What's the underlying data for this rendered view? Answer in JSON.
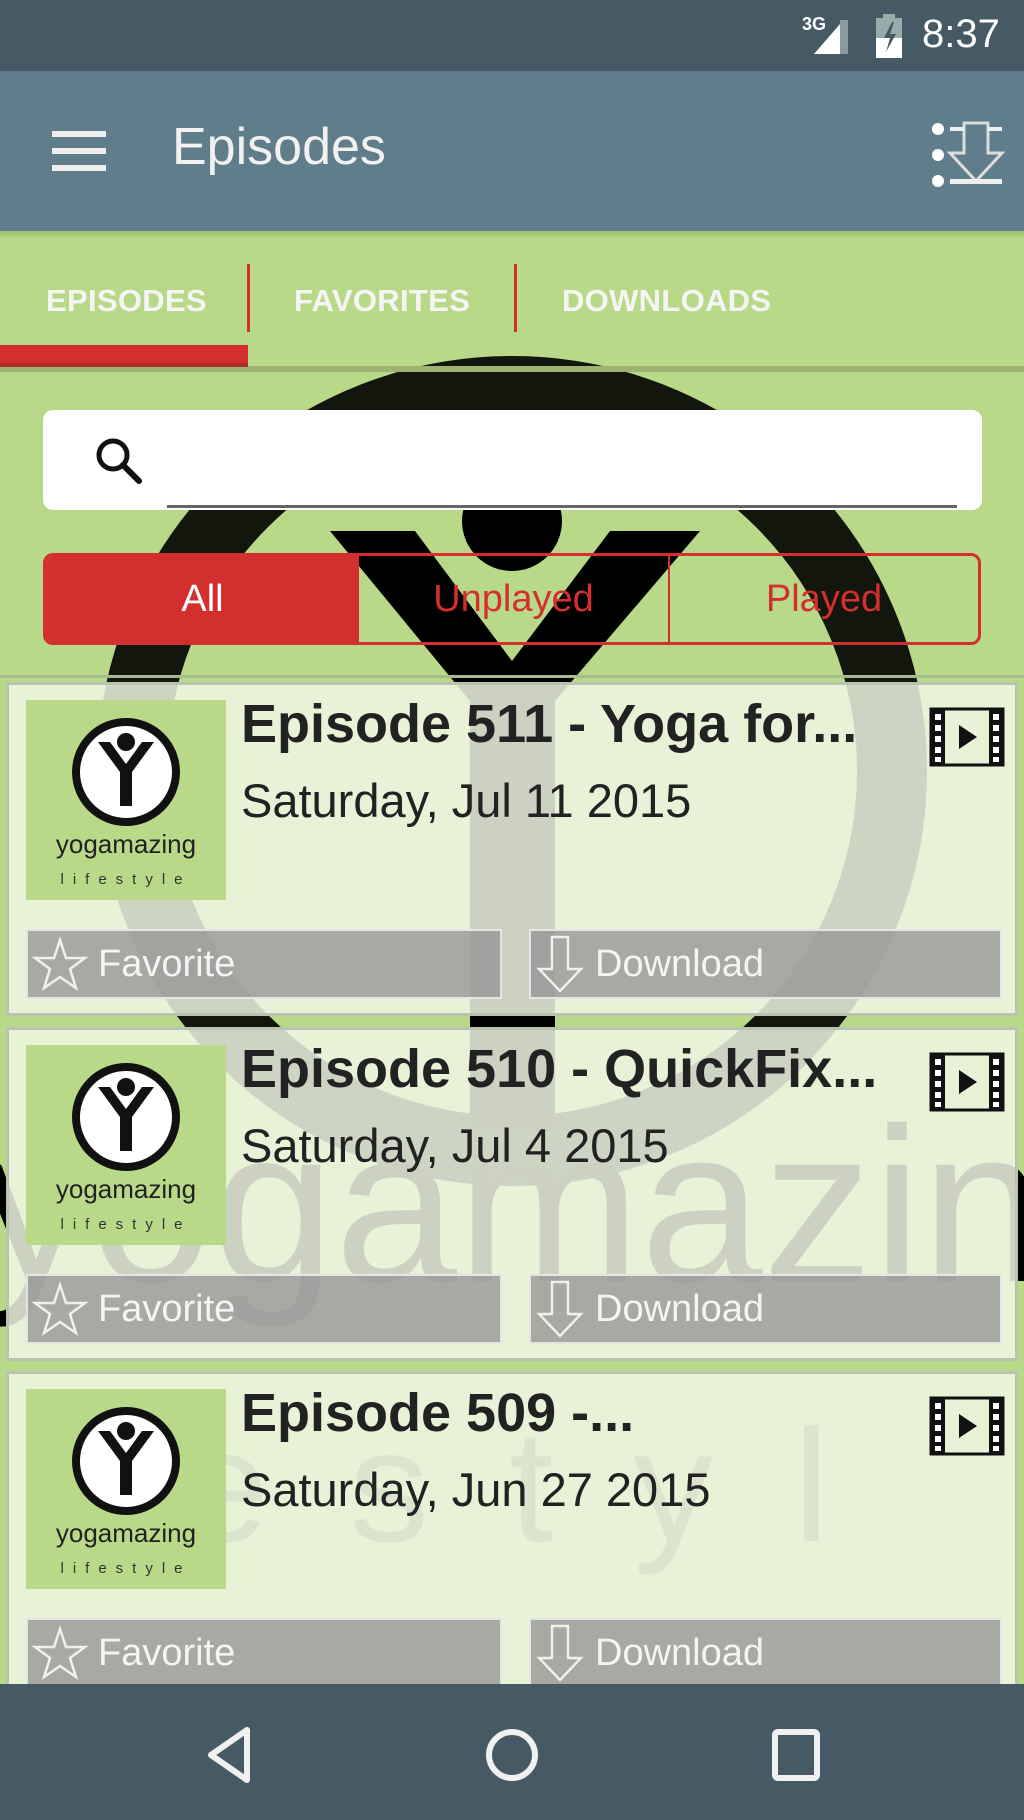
{
  "status_bar": {
    "network": "3G",
    "time": "8:37"
  },
  "app_bar": {
    "title": "Episodes",
    "menu_icon": "hamburger-menu-icon",
    "action_icon": "download-all-icon"
  },
  "tabs": [
    {
      "label": "EPISODES",
      "active": true
    },
    {
      "label": "FAVORITES",
      "active": false
    },
    {
      "label": "DOWNLOADS",
      "active": false
    }
  ],
  "search": {
    "icon": "search-icon",
    "value": "",
    "placeholder": ""
  },
  "filter": {
    "options": [
      "All",
      "Unplayed",
      "Played"
    ],
    "selected": "All"
  },
  "colors": {
    "accent": "#d32f2f",
    "app_bar": "#607d8b",
    "status_bar": "#455a64",
    "background": "#b8d987"
  },
  "episodes": [
    {
      "title": "Episode 511 - Yoga for...",
      "date": "Saturday, Jul 11 2015",
      "thumb_brand": "yogamazing",
      "thumb_sub": "lifestyle",
      "favorite_label": "Favorite",
      "download_label": "Download"
    },
    {
      "title": "Episode 510 - QuickFix...",
      "date": "Saturday, Jul 4 2015",
      "thumb_brand": "yogamazing",
      "thumb_sub": "lifestyle",
      "favorite_label": "Favorite",
      "download_label": "Download"
    },
    {
      "title": "Episode 509 -...",
      "date": "Saturday, Jun 27 2015",
      "thumb_brand": "yogamazing",
      "thumb_sub": "lifestyle",
      "favorite_label": "Favorite",
      "download_label": "Download"
    }
  ],
  "nav_bar": {
    "back": "back-icon",
    "home": "home-icon",
    "recents": "recents-icon"
  }
}
